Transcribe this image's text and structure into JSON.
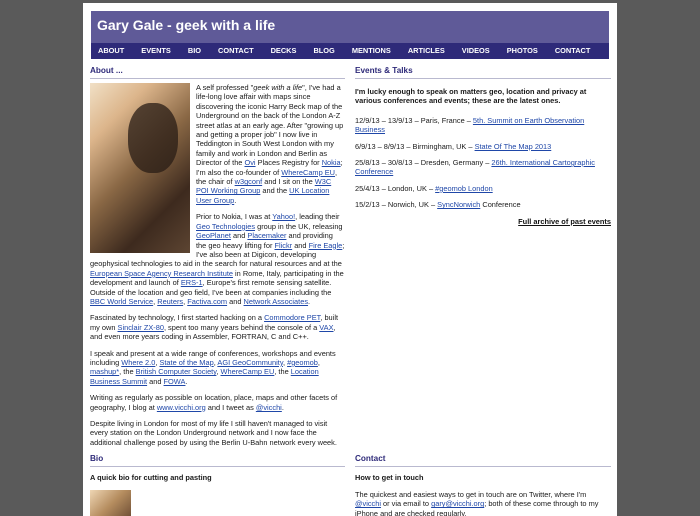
{
  "site": {
    "title": "Gary Gale - geek with a life"
  },
  "nav": [
    "ABOUT",
    "EVENTS",
    "BIO",
    "CONTACT",
    "DECKS",
    "BLOG",
    "MENTIONS",
    "ARTICLES",
    "VIDEOS",
    "PHOTOS",
    "CONTACT"
  ],
  "about": {
    "heading": "About ...",
    "p1": [
      "A self professed \"",
      {
        "em": "geek with a life"
      },
      "\", I've had a life-long love affair with maps since discovering the iconic Harry Beck map of the Underground on the back of the London A-Z street atlas at an early age. After \"growing up and getting a proper job\" I now live in Teddington in South West London with my family and work in London and Berlin as Director of the ",
      {
        "link": "Ovi"
      },
      " Places Registry for ",
      {
        "link": "Nokia"
      },
      "; I'm also the co-founder of ",
      {
        "link": "WhereCamp EU"
      },
      ", the chair of ",
      {
        "link": "w3gconf"
      },
      " and I sit on the ",
      {
        "link": "W3C POI Working Group"
      },
      " and the ",
      {
        "link": "UK Location User Group"
      },
      "."
    ],
    "p2": [
      "Prior to Nokia, I was at ",
      {
        "link": "Yahoo!"
      },
      ", leading their ",
      {
        "link": "Geo Technologies"
      },
      " group in the UK, releasing ",
      {
        "link": "GeoPlanet"
      },
      " and ",
      {
        "link": "Placemaker"
      },
      " and providing the geo heavy lifting for ",
      {
        "link": "Flickr"
      },
      " and ",
      {
        "link": "Fire Eagle"
      },
      "; I've also been at Digicon, developing geophysical technologies to aid in the search for natural resources and at the ",
      {
        "link": "European Space Agency Research Institute"
      },
      " in Rome, Italy, participating in the development and launch of ",
      {
        "link": "ERS-1"
      },
      ", Europe's first remote sensing satellite. Outside of the location and geo field, I've been at companies including the ",
      {
        "link": "BBC World Service"
      },
      ", ",
      {
        "link": "Reuters"
      },
      ", ",
      {
        "link": "Factiva.com"
      },
      " and ",
      {
        "link": "Network Associates"
      },
      "."
    ],
    "p3": [
      "Fascinated by technology, I first started hacking on a ",
      {
        "link": "Commodore PET"
      },
      ", built my own ",
      {
        "link": "Sinclair ZX-80"
      },
      ", spent too many years behind the console of a ",
      {
        "link": "VAX"
      },
      ", and even more years coding in Assembler, FORTRAN, C and C++."
    ],
    "p4": [
      "I speak and present at a wide range of conferences, workshops and events including ",
      {
        "link": "Where 2.0"
      },
      ", ",
      {
        "link": "State of the Map"
      },
      ", ",
      {
        "link": "AGI GeoCommunity"
      },
      ", ",
      {
        "link": "#geomob"
      },
      ", ",
      {
        "link": "mashup*"
      },
      ", the ",
      {
        "link": "British Computer Society"
      },
      ", ",
      {
        "link": "WhereCamp EU"
      },
      ", the ",
      {
        "link": "Location Business Summit"
      },
      " and ",
      {
        "link": "FOWA"
      },
      "."
    ],
    "p5": [
      "Writing as regularly as possible on location, place, maps and other facets of geography, I blog at ",
      {
        "link": "www.vicchi.org"
      },
      " and I tweet as ",
      {
        "link": "@vicchi"
      },
      "."
    ],
    "p6": [
      "Despite living in London for most of my life I still haven't managed to visit every station on the London Underground network and I now face the additional challenge posed by using the Berlin U-Bahn network every week."
    ]
  },
  "events": {
    "heading": "Events & Talks",
    "intro": "I'm lucky enough to speak on matters geo, location and privacy at various conferences and events; these are the latest ones.",
    "items": [
      {
        "date": "12/9/13 – 13/9/13 – Paris, France – ",
        "link": "5th. Summit on Earth Observation Business",
        "after": ""
      },
      {
        "date": "6/9/13 – 8/9/13 – Birmingham, UK – ",
        "link": "State Of The Map 2013",
        "after": ""
      },
      {
        "date": "25/8/13 – 30/8/13 – Dresden, Germany – ",
        "link": "26th. International Cartographic Conference",
        "after": ""
      },
      {
        "date": "25/4/13 – London, UK – ",
        "link": "#geomob London",
        "after": ""
      },
      {
        "date": "15/2/13 – Norwich, UK – ",
        "link": "SyncNorwich",
        "after": " Conference"
      }
    ],
    "archive": "Full archive of past events"
  },
  "bio": {
    "heading": "Bio",
    "sub": "A quick bio for cutting and pasting"
  },
  "contact": {
    "heading": "Contact",
    "sub": "How to get in touch",
    "text": [
      "The quickest and easiest ways to get in touch are on Twitter, where I'm ",
      {
        "link": "@vicchi"
      },
      " or via email to ",
      {
        "link": "gary@vicchi.org"
      },
      "; both of these come through to my iPhone and are checked regularly."
    ]
  }
}
